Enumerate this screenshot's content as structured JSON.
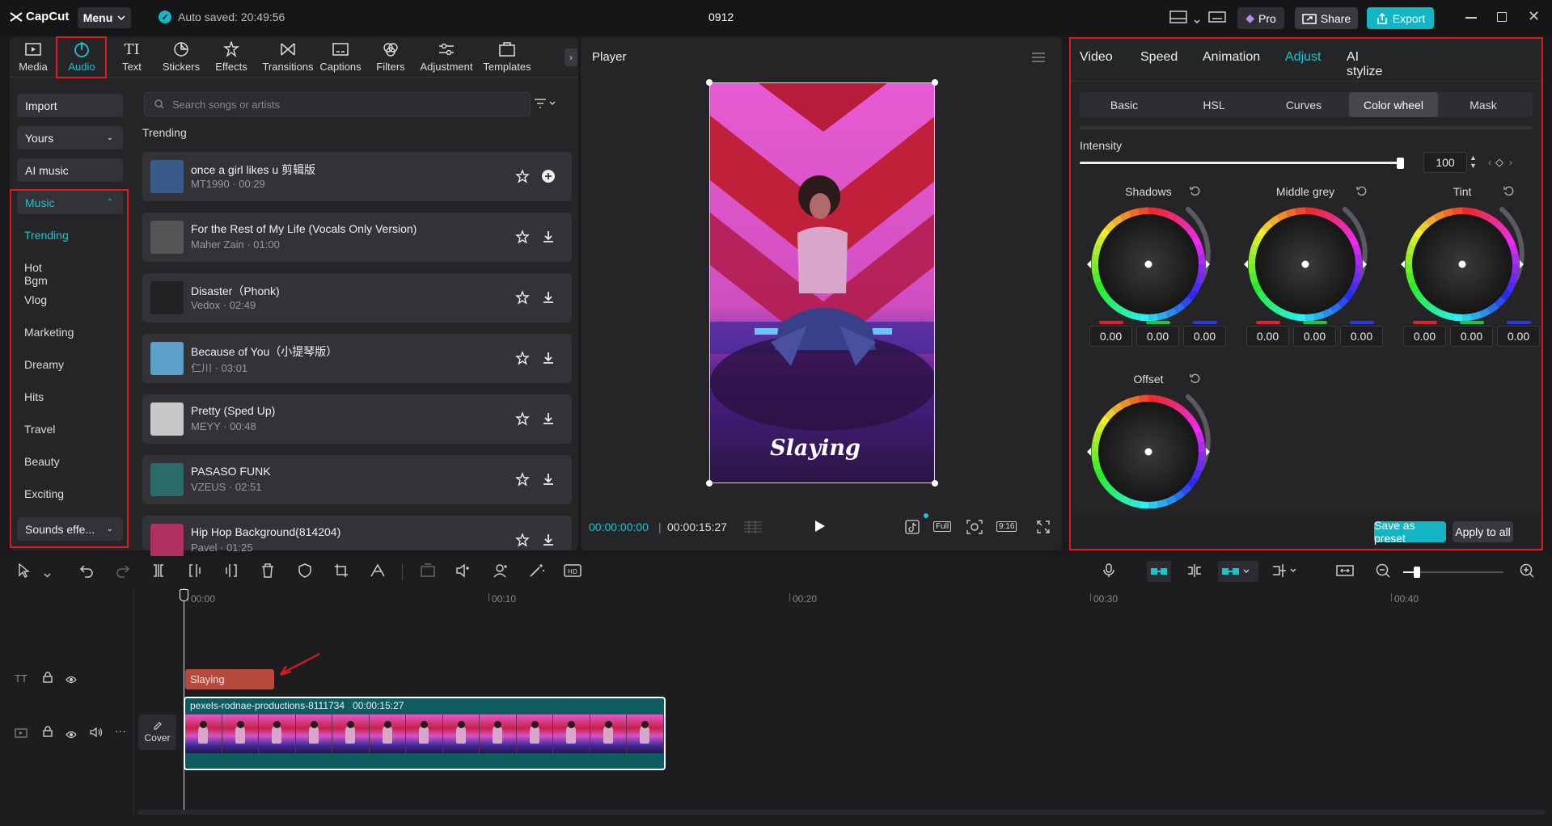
{
  "app": {
    "logo": "CapCut",
    "menu_label": "Menu",
    "autosave": "Auto saved: 20:49:56",
    "project_name": "0912"
  },
  "toolbar_right": {
    "pro": "Pro",
    "share": "Share",
    "export": "Export"
  },
  "media_tabs": [
    "Media",
    "Audio",
    "Text",
    "Stickers",
    "Effects",
    "Transitions",
    "Captions",
    "Filters",
    "Adjustment",
    "Templates"
  ],
  "sidebar": {
    "import": "Import",
    "yours": "Yours",
    "ai_music": "AI music",
    "music": "Music",
    "items": [
      "Trending",
      "Hot Bgm",
      "Vlog",
      "Marketing",
      "Dreamy",
      "Hits",
      "Travel",
      "Beauty",
      "Exciting"
    ],
    "sounds": "Sounds effe..."
  },
  "search": {
    "placeholder": "Search songs or artists"
  },
  "section_title": "Trending",
  "tracks": [
    {
      "title": "once a girl likes u 剪辑版",
      "sub": "MT1990 · 00:29",
      "action": "add",
      "color": "#3a5a8a"
    },
    {
      "title": "For the Rest of My Life (Vocals Only Version)",
      "sub": "Maher Zain · 01:00",
      "action": "download",
      "color": "#555555"
    },
    {
      "title": "Disaster（Phonk)",
      "sub": "Vedox · 02:49",
      "action": "download",
      "color": "#222222"
    },
    {
      "title": "Because of You（小提琴版）",
      "sub": "仁川 · 03:01",
      "action": "download",
      "color": "#5aa0c8"
    },
    {
      "title": "Pretty (Sped Up)",
      "sub": "MEYY · 00:48",
      "action": "download",
      "color": "#c8c8c8"
    },
    {
      "title": "PASASO FUNK",
      "sub": "VZEUS · 02:51",
      "action": "download",
      "color": "#2a6a6a"
    },
    {
      "title": "Hip Hop Background(814204)",
      "sub": "Pavel · 01:25",
      "action": "download",
      "color": "#b03060"
    }
  ],
  "player": {
    "title": "Player",
    "caption": "Slaying",
    "time_current": "00:00:00:00",
    "time_total": "00:00:15:27",
    "full_label": "Full",
    "ratio_label": "9:16"
  },
  "props": {
    "tabs": [
      "Video",
      "Speed",
      "Animation",
      "Adjust",
      "AI stylize"
    ],
    "active_tab": "Adjust",
    "subtabs": [
      "Basic",
      "HSL",
      "Curves",
      "Color wheel",
      "Mask"
    ],
    "active_subtab": "Color wheel",
    "intensity_label": "Intensity",
    "intensity_value": "100",
    "intensity_level": 1.0,
    "wheels": [
      {
        "label": "Shadows",
        "values": [
          "0.00",
          "0.00",
          "0.00"
        ]
      },
      {
        "label": "Middle grey",
        "values": [
          "0.00",
          "0.00",
          "0.00"
        ]
      },
      {
        "label": "Tint",
        "values": [
          "0.00",
          "0.00",
          "0.00"
        ]
      },
      {
        "label": "Offset",
        "values": []
      }
    ],
    "save_preset": "Save as preset",
    "apply_all": "Apply to all"
  },
  "timeline": {
    "ruler": [
      "00:00",
      "00:10",
      "00:20",
      "00:30",
      "00:40"
    ],
    "text_clip": "Slaying",
    "video_clip_name": "pexels-rodnae-productions-8111734",
    "video_clip_duration": "00:00:15:27",
    "cover_label": "Cover"
  },
  "colors": {
    "accent": "#1ec3d0",
    "highlight_box": "#e0191f",
    "text_clip": "#b8493e",
    "video_clip": "#0f5b5f"
  }
}
